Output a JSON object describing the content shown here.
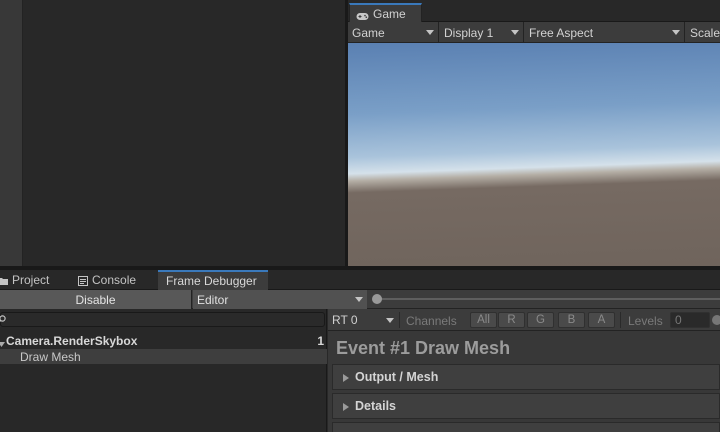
{
  "game_view": {
    "tab_label": "Game",
    "toolbar": {
      "view_mode": "Game",
      "display": "Display 1",
      "aspect": "Free Aspect",
      "scale_label": "Scale"
    }
  },
  "bottom_tabs": [
    {
      "label": "Project",
      "icon": "folder-icon"
    },
    {
      "label": "Console",
      "icon": "console-icon"
    },
    {
      "label": "Frame Debugger",
      "active": true
    }
  ],
  "frame_debugger": {
    "disable_label": "Disable",
    "target": "Editor",
    "tree": {
      "rows": [
        {
          "label": "Camera.RenderSkybox",
          "count": "1"
        },
        {
          "label": "Draw Mesh"
        }
      ]
    },
    "details": {
      "rt_label": "RT 0",
      "channels_label": "Channels",
      "channels": [
        "All",
        "R",
        "G",
        "B",
        "A"
      ],
      "levels_label": "Levels",
      "levels_value": "0",
      "event_title": "Event #1 Draw Mesh",
      "foldouts": [
        "Output / Mesh",
        "Details"
      ]
    }
  },
  "colors": {
    "accent": "#3a79bb",
    "panel": "#383838",
    "toolbar": "#3c3c3c"
  }
}
